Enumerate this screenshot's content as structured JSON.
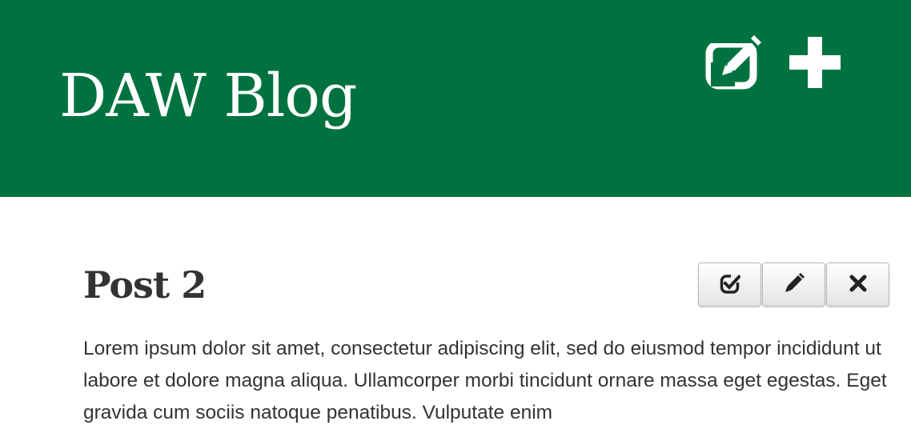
{
  "header": {
    "title": "DAW Blog",
    "background_color": "#00723f",
    "actions": [
      {
        "icon": "edit-square-icon"
      },
      {
        "icon": "plus-icon"
      }
    ]
  },
  "post": {
    "title": "Post 2",
    "actions": [
      {
        "icon": "check-square-icon"
      },
      {
        "icon": "pencil-icon"
      },
      {
        "icon": "close-icon"
      }
    ],
    "body": "Lorem ipsum dolor sit amet, consectetur adipiscing elit, sed do eiusmod tempor incididunt ut labore et dolore magna aliqua. Ullamcorper morbi tincidunt ornare massa eget egestas. Eget gravida cum sociis natoque penatibus. Vulputate enim"
  }
}
